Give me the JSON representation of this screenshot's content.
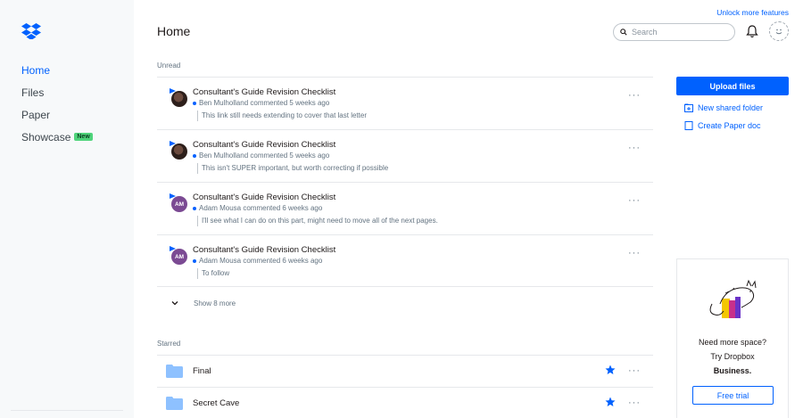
{
  "colors": {
    "accent": "#0061fe",
    "sidebar_bg": "#f7f9fa",
    "new_badge": "#4fd47b",
    "folder": "#8ec1ff"
  },
  "top": {
    "unlock_link": "Unlock more features",
    "title": "Home",
    "search_placeholder": "Search"
  },
  "sidebar": {
    "items": [
      {
        "label": "Home"
      },
      {
        "label": "Files"
      },
      {
        "label": "Paper"
      },
      {
        "label": "Showcase",
        "badge": "New"
      }
    ]
  },
  "unread": {
    "label": "Unread",
    "items": [
      {
        "title": "Consultant's Guide Revision Checklist",
        "meta": "Ben Mulholland commented 5 weeks ago",
        "comment": "This link still needs extending to cover that last letter",
        "avatar": "photo"
      },
      {
        "title": "Consultant's Guide Revision Checklist",
        "meta": "Ben Mulholland commented 5 weeks ago",
        "comment": "This isn't SUPER important, but worth correcting if possible",
        "avatar": "photo"
      },
      {
        "title": "Consultant's Guide Revision Checklist",
        "meta": "Adam Mousa commented 6 weeks ago",
        "comment": "I'll see what I can do on this part, might need to move all of the next pages.",
        "avatar": "AM"
      },
      {
        "title": "Consultant's Guide Revision Checklist",
        "meta": "Adam Mousa commented 6 weeks ago",
        "comment": "To follow",
        "avatar": "AM"
      }
    ],
    "show_more": "Show 8 more"
  },
  "starred": {
    "label": "Starred",
    "items": [
      {
        "name": "Final"
      },
      {
        "name": "Secret Cave"
      }
    ]
  },
  "actions": {
    "upload": "Upload files",
    "new_shared_folder": "New shared folder",
    "create_paper_doc": "Create Paper doc"
  },
  "promo": {
    "line1": "Need more space?",
    "line2": "Try Dropbox",
    "line3": "Business.",
    "button": "Free trial"
  },
  "icons": [
    "dropbox-logo-icon",
    "search-icon",
    "bell-icon",
    "more-icon",
    "chevron-down-icon",
    "folder-icon",
    "star-icon",
    "new-shared-folder-icon",
    "paper-doc-icon"
  ]
}
